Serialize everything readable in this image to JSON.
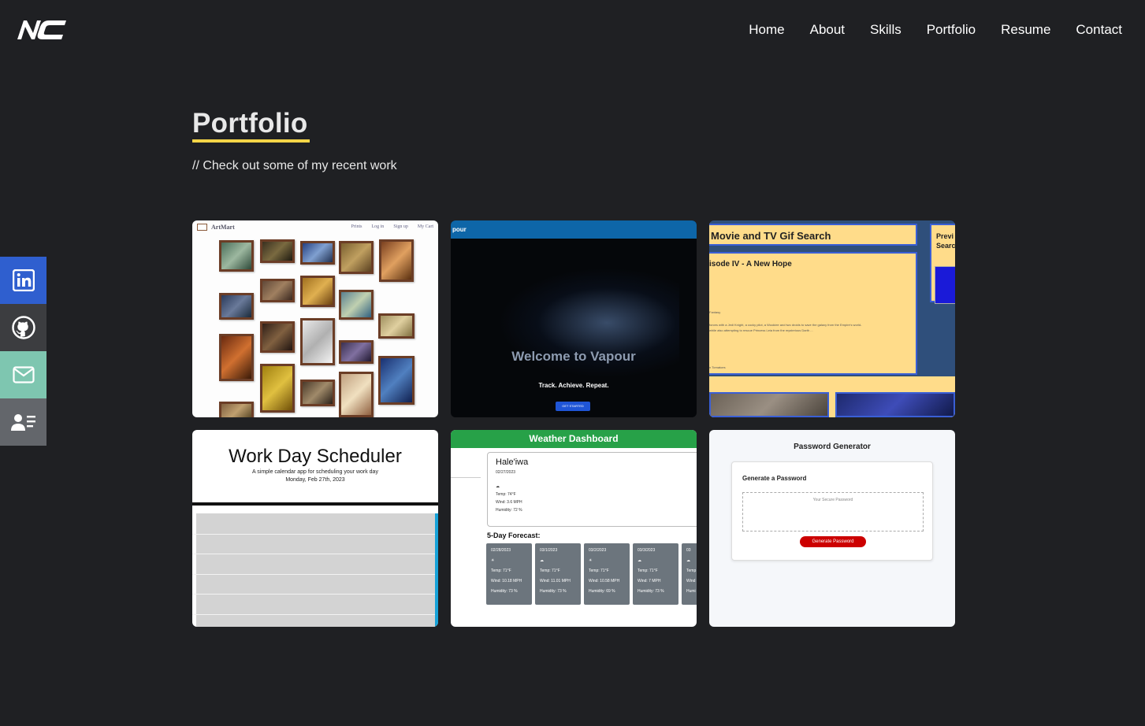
{
  "logo": {
    "text": "NC"
  },
  "nav": {
    "items": [
      "Home",
      "About",
      "Skills",
      "Portfolio",
      "Resume",
      "Contact"
    ]
  },
  "page": {
    "title": "Portfolio",
    "subtitle": "// Check out some of my recent work"
  },
  "social": {
    "linkedin": {
      "icon": "linkedin-icon",
      "color": "#2f5fcf"
    },
    "github": {
      "icon": "github-icon",
      "color": "#3c3d40"
    },
    "email": {
      "icon": "mail-icon",
      "color": "#7ec6b0"
    },
    "resume": {
      "icon": "resume-icon",
      "color": "#63666b"
    }
  },
  "projects": {
    "artmart": {
      "brand": "ArtMart",
      "links": [
        "Prints",
        "Log in",
        "Sign up",
        "My Cart"
      ]
    },
    "vapour": {
      "nav": "pour",
      "welcome": "Welcome to Vapour",
      "tagline": "Track. Achieve. Repeat.",
      "button": "GET STARTED"
    },
    "gif": {
      "header": "Movie and TV Gif Search",
      "previous": "Previ Searc",
      "result_title": "isode IV - A New Hope",
      "small1": "Fantasy",
      "small2": "forces with a Jedi Knight, a cocky pilot, a Wookiee and two droids to save the galaxy from the Empire's world-",
      "small3": "while also attempting to rescue Princess Leia from the mysterious Darth ...",
      "small4": "n Tomatoes"
    },
    "scheduler": {
      "title": "Work Day Scheduler",
      "subtitle": "A simple calendar app for scheduling your work day",
      "date": "Monday, Feb 27th, 2023"
    },
    "weather": {
      "header": "Weather Dashboard",
      "city": "Hale'iwa",
      "date": "02/27/2023",
      "temp": "Temp: 74°F",
      "wind": "Wind: 3.6 MPH",
      "humidity": "Humidity: 72 %",
      "forecast_label": "5-Day Forecast:",
      "days": [
        {
          "date": "02/28/2023",
          "temp": "Temp: 71°F",
          "wind": "Wind: 10.18 MPH",
          "humidity": "Humidity: 73 %"
        },
        {
          "date": "03/1/2023",
          "temp": "Temp: 71°F",
          "wind": "Wind: 11.01 MPH",
          "humidity": "Humidity: 73 %"
        },
        {
          "date": "03/2/2023",
          "temp": "Temp: 71°F",
          "wind": "Wind: 10.58 MPH",
          "humidity": "Humidity: 69 %"
        },
        {
          "date": "03/3/2023",
          "temp": "Temp: 71°F",
          "wind": "Wind: 7 MPH",
          "humidity": "Humidity: 73 %"
        },
        {
          "date": "03",
          "temp": "Temp",
          "wind": "Wind",
          "humidity": "Humi"
        }
      ]
    },
    "password": {
      "title": "Password Generator",
      "heading": "Generate a Password",
      "placeholder": "Your Secure Password",
      "button": "Generate Password"
    }
  }
}
